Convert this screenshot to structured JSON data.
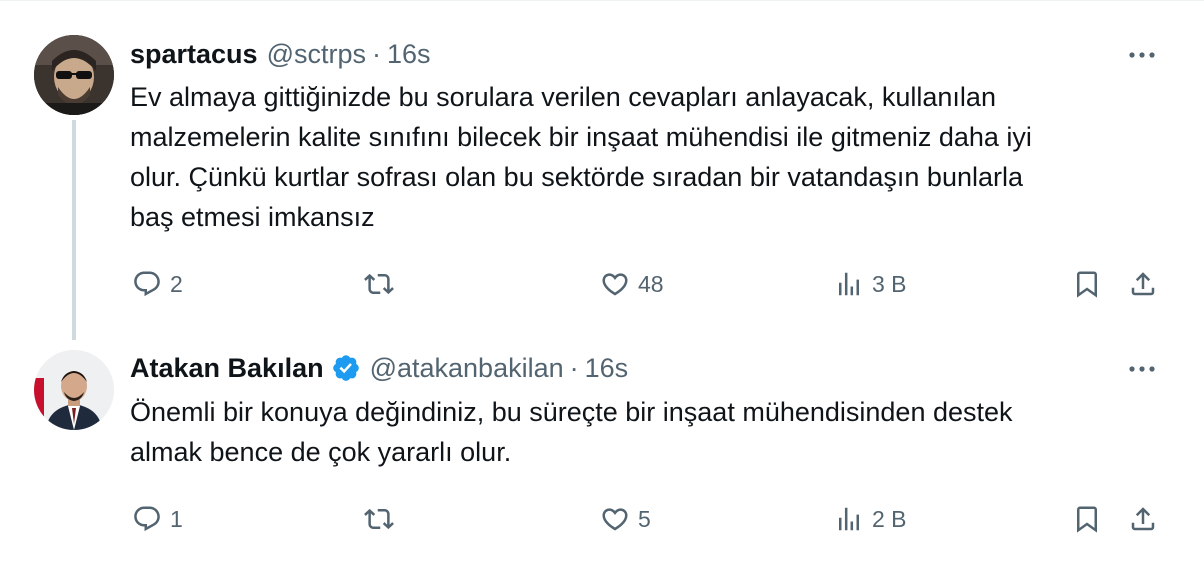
{
  "tweets": [
    {
      "name": "spartacus",
      "handle": "@sctrps",
      "separator": "·",
      "time": "16s",
      "text": "Ev almaya gittiğinizde bu sorulara verilen cevapları anlayacak, kullanılan\nmalzemelerin kalite sınıfını bilecek bir inşaat mühendisi ile gitmeniz daha iyi\nolur. Çünkü kurtlar sofrası olan bu sektörde sıradan bir vatandaşın bunlarla\nbaş etmesi imkansız",
      "replies": "2",
      "likes": "48",
      "views": "3 B",
      "verified": false
    },
    {
      "name": "Atakan Bakılan",
      "handle": "@atakanbakilan",
      "separator": "·",
      "time": "16s",
      "text": "Önemli bir konuya değindiniz, bu süreçte bir inşaat mühendisinden destek\nalmak bence de çok yararlı olur.",
      "replies": "1",
      "likes": "5",
      "views": "2 B",
      "verified": true
    }
  ],
  "icons": {
    "reply": "reply-icon",
    "retweet": "retweet-icon",
    "like": "heart-icon",
    "views": "views-icon",
    "bookmark": "bookmark-icon",
    "share": "share-icon",
    "more": "more-icon",
    "verified": "verified-badge-icon"
  },
  "colors": {
    "text": "#0f1419",
    "secondary": "#536471",
    "verified": "#1d9bf0",
    "thread_line": "#cfd9de"
  }
}
